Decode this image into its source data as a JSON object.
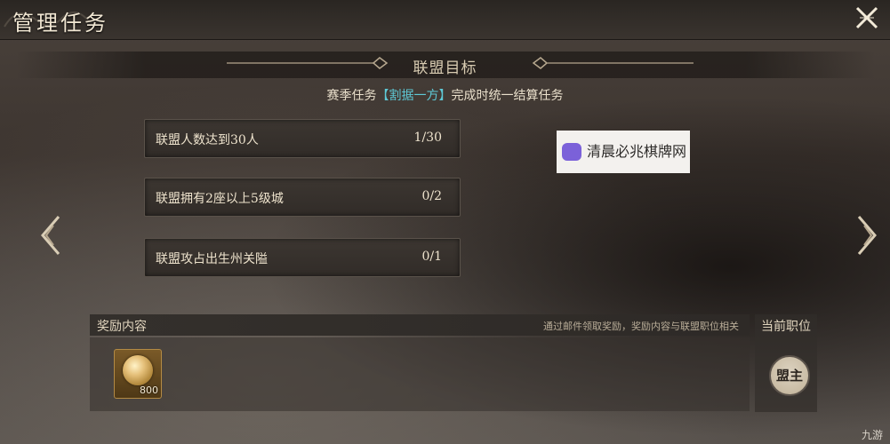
{
  "window": {
    "title": "管理任务"
  },
  "section": {
    "title": "联盟目标"
  },
  "subtitle": {
    "prefix": "赛季任务",
    "highlight": "【割据一方】",
    "suffix": "完成时统一结算任务"
  },
  "tasks": [
    {
      "label": "联盟人数达到30人",
      "progress": "1/30"
    },
    {
      "label": "联盟拥有2座以上5级城",
      "progress": "0/2"
    },
    {
      "label": "联盟攻占出生州关隘",
      "progress": "0/1"
    }
  ],
  "watermark": {
    "text": "清晨必兆棋牌网"
  },
  "rewards": {
    "label": "奖励内容",
    "note": "通过邮件领取奖励，奖励内容与联盟职位相关",
    "items": [
      {
        "icon": "gold-coin-icon",
        "quantity": "800"
      }
    ]
  },
  "position": {
    "label": "当前职位",
    "badge": "盟主"
  },
  "corner": {
    "text": "九游"
  },
  "colors": {
    "highlight": "#5ec9d6",
    "accent_gold": "#b38a44"
  }
}
